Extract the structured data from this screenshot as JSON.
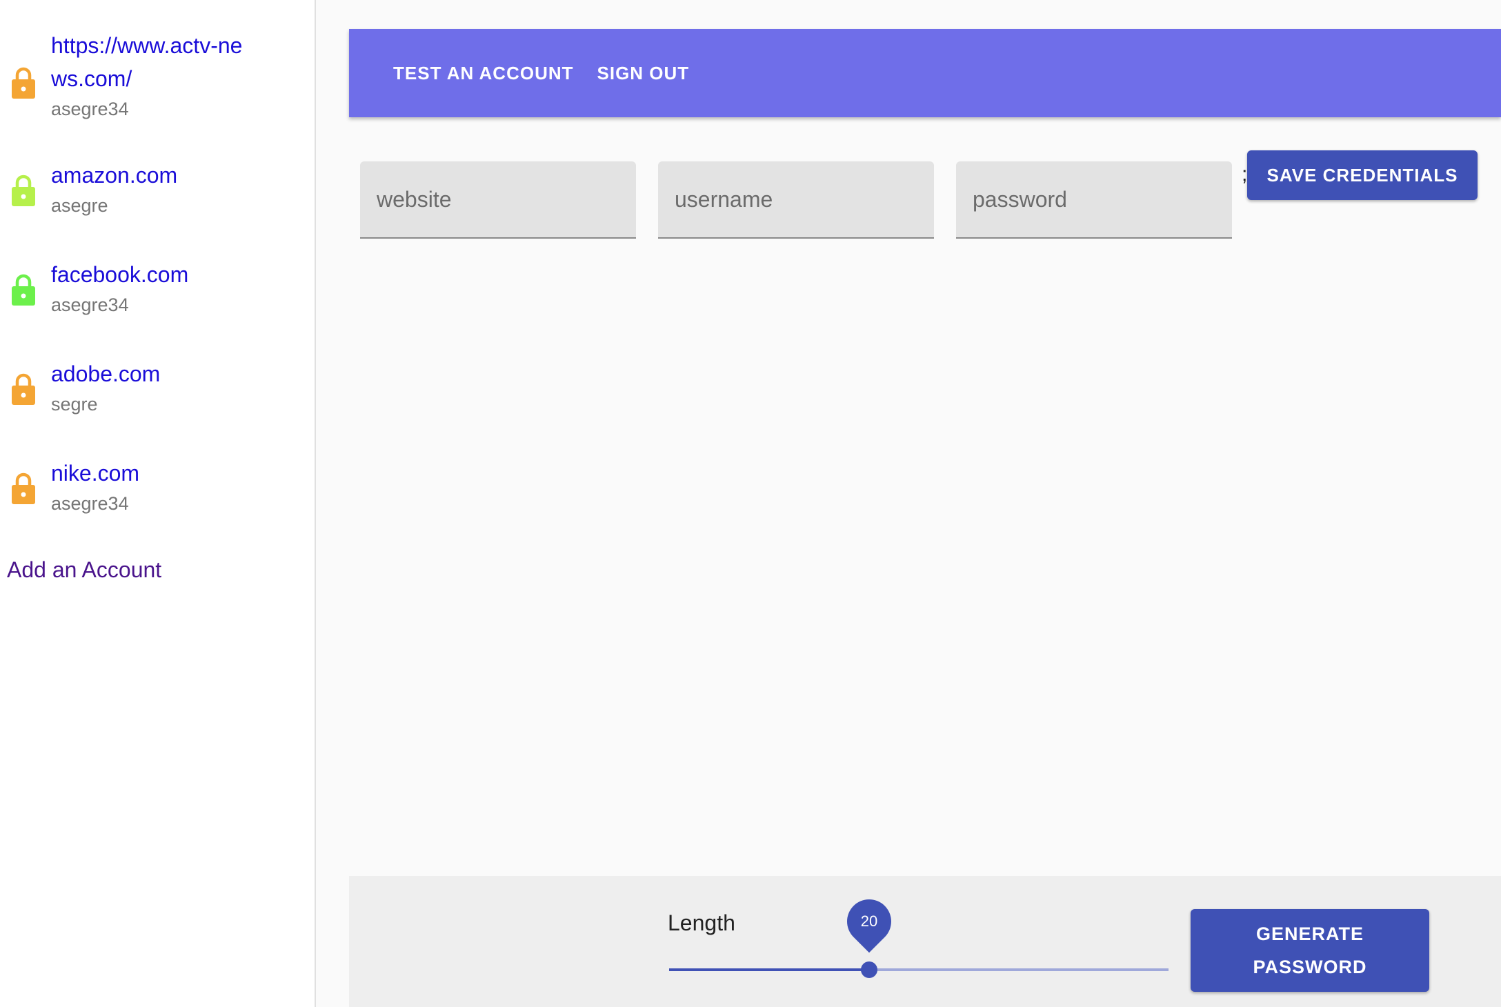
{
  "sidebar": {
    "accounts": [
      {
        "site": "https://www.actv-news.com/",
        "user": "asegre34",
        "lock_color": "#f4a534",
        "lock_icon": "lock-icon"
      },
      {
        "site": "amazon.com",
        "user": "asegre",
        "lock_color": "#b6f04b",
        "lock_icon": "lock-icon"
      },
      {
        "site": "facebook.com",
        "user": "asegre34",
        "lock_color": "#6cf04b",
        "lock_icon": "lock-icon"
      },
      {
        "site": "adobe.com",
        "user": "segre",
        "lock_color": "#f4a534",
        "lock_icon": "lock-icon"
      },
      {
        "site": "nike.com",
        "user": "asegre34",
        "lock_color": "#f4a534",
        "lock_icon": "lock-icon"
      }
    ],
    "add_account_label": "Add an Account"
  },
  "header": {
    "test_account_label": "TEST AN ACCOUNT",
    "sign_out_label": "SIGN OUT",
    "color": "#6f6ee9"
  },
  "form": {
    "website": {
      "placeholder": "website",
      "value": ""
    },
    "username": {
      "placeholder": "username",
      "value": ""
    },
    "password": {
      "placeholder": "password",
      "value": ""
    },
    "stray_text": ";",
    "save_label": "SAVE CREDENTIALS"
  },
  "generator": {
    "length_label": "Length",
    "length_value": "20",
    "slider_fraction": 0.4,
    "generate_label": "GENERATE PASSWORD",
    "accent": "#3f51b5"
  }
}
